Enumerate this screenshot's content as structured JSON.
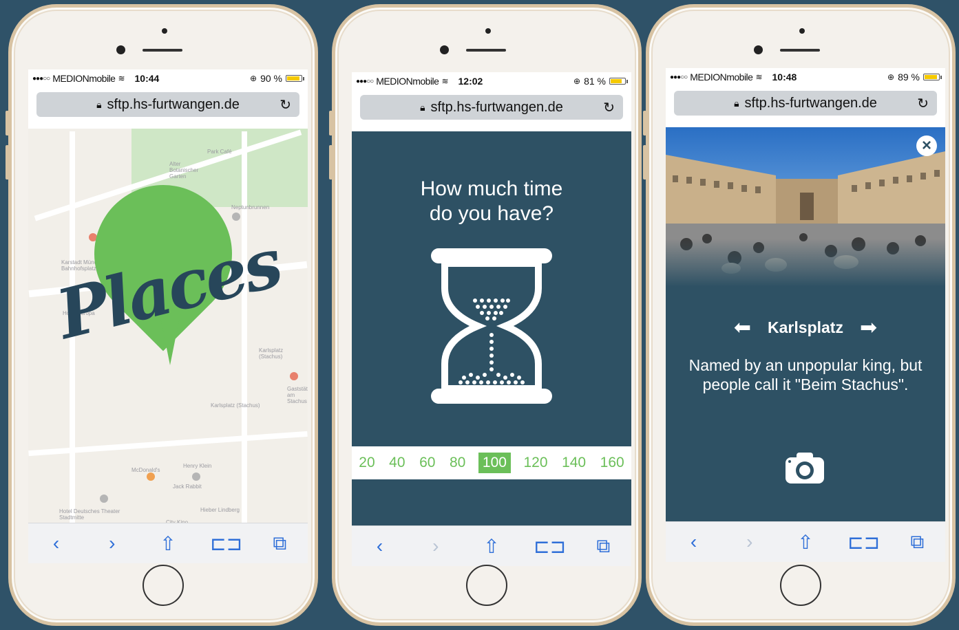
{
  "phones": [
    {
      "status": {
        "signal": "●●●○○",
        "carrier": "MEDIONmobile",
        "time": "10:44",
        "battery": "90 %",
        "battery_level": 0.9
      },
      "url": "sftp.hs-furtwangen.de",
      "logo_text": "Places",
      "map_labels": [
        "Park Café",
        "Alter Botanischer Garten",
        "Neptunbrunnen",
        "Karstadt München Bahnhofsplatz",
        "Hotel Europa",
        "Karlsplatz (Stachus)",
        "Karlsplatz (Stachus)",
        "McDonald's",
        "Henry Klein",
        "Jack Rabbit",
        "Hotel Deutsches Theater Stadtmitte",
        "City Kino",
        "Hieber Lindberg",
        "Gaststätte am Stachus"
      ]
    },
    {
      "status": {
        "signal": "●●●○○",
        "carrier": "MEDIONmobile",
        "time": "12:02",
        "battery": "81 %",
        "battery_level": 0.81
      },
      "url": "sftp.hs-furtwangen.de",
      "question_line1": "How much time",
      "question_line2": "do you have?",
      "time_options": [
        "20",
        "40",
        "60",
        "80",
        "100",
        "120",
        "140",
        "160"
      ],
      "selected_time": "100"
    },
    {
      "status": {
        "signal": "●●●○○",
        "carrier": "MEDIONmobile",
        "time": "10:48",
        "battery": "89 %",
        "battery_level": 0.89
      },
      "url": "sftp.hs-furtwangen.de",
      "place_title": "Karlsplatz",
      "place_description": "Named by an unpopular king, but people call it \"Beim Stachus\"."
    }
  ],
  "toolbar_icons": [
    "back-icon",
    "forward-icon",
    "share-icon",
    "bookmarks-icon",
    "tabs-icon"
  ],
  "colors": {
    "background": "#2f5268",
    "screen_dark": "#2e5164",
    "accent_green": "#6bbf59",
    "ios_blue": "#2f6fd8"
  }
}
